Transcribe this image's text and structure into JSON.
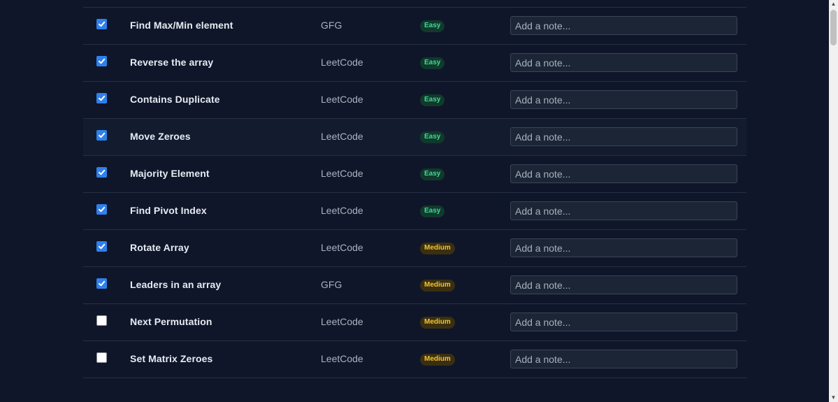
{
  "note_placeholder": "Add a note...",
  "colors": {
    "background": "#0f1629",
    "checkbox_checked": "#2f80ed",
    "easy_text": "#3ddc97",
    "easy_bg": "#11392c",
    "medium_text": "#f5c531",
    "medium_bg": "#3a2f10"
  },
  "problems": [
    {
      "name": "Find Max/Min element",
      "platform": "GFG",
      "difficulty": "Easy",
      "completed": true
    },
    {
      "name": "Reverse the array",
      "platform": "LeetCode",
      "difficulty": "Easy",
      "completed": true
    },
    {
      "name": "Contains Duplicate",
      "platform": "LeetCode",
      "difficulty": "Easy",
      "completed": true
    },
    {
      "name": "Move Zeroes",
      "platform": "LeetCode",
      "difficulty": "Easy",
      "completed": true
    },
    {
      "name": "Majority Element",
      "platform": "LeetCode",
      "difficulty": "Easy",
      "completed": true
    },
    {
      "name": "Find Pivot Index",
      "platform": "LeetCode",
      "difficulty": "Easy",
      "completed": true
    },
    {
      "name": "Rotate Array",
      "platform": "LeetCode",
      "difficulty": "Medium",
      "completed": true
    },
    {
      "name": "Leaders in an array",
      "platform": "GFG",
      "difficulty": "Medium",
      "completed": true
    },
    {
      "name": "Next Permutation",
      "platform": "LeetCode",
      "difficulty": "Medium",
      "completed": false
    },
    {
      "name": "Set Matrix Zeroes",
      "platform": "LeetCode",
      "difficulty": "Medium",
      "completed": false
    }
  ],
  "icons": {
    "checkbox_check": "check-icon",
    "scroll_up": "scroll-up-arrow-icon",
    "scroll_down": "scroll-down-arrow-icon"
  }
}
